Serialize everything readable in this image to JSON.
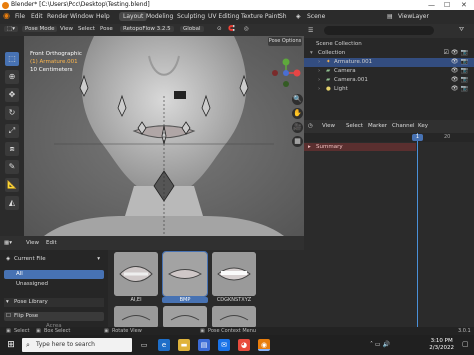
{
  "window": {
    "title": "Blender* [C:\\Users\\Pcc\\Desktop\\Testing.blend]",
    "minimize": "—",
    "maximize": "☐",
    "close": "✕"
  },
  "menubar": {
    "items": [
      "File",
      "Edit",
      "Render",
      "Window",
      "Help"
    ],
    "workspaces": [
      "Layout",
      "Modeling",
      "Sculpting",
      "UV Editing",
      "Texture Paint",
      "Sh"
    ],
    "active_workspace": "Layout",
    "scene_label": "Scene",
    "viewlayer_label": "ViewLayer"
  },
  "viewport_header": {
    "mode": "Pose Mode",
    "menus": [
      "View",
      "Select",
      "Pose"
    ],
    "addon": "RetopoFlow 3.2.5",
    "orientation": "Global",
    "pose_options": "Pose Options"
  },
  "viewport_info": {
    "view_name": "Front Orthographic",
    "selection": "(1) Armature.001",
    "scale": "10 Centimeters"
  },
  "outliner": {
    "root": "Scene Collection",
    "items": [
      {
        "label": "Collection",
        "indent": 1,
        "selected": false
      },
      {
        "label": "Armature.001",
        "indent": 2,
        "selected": true
      },
      {
        "label": "Camera",
        "indent": 2,
        "selected": false
      },
      {
        "label": "Camera.001",
        "indent": 2,
        "selected": false
      },
      {
        "label": "Light",
        "indent": 2,
        "selected": false
      }
    ]
  },
  "dopesheet": {
    "menus": [
      "View",
      "Select",
      "Marker",
      "Channel",
      "Key"
    ],
    "current_frame": "1",
    "ruler_marks": [
      "1",
      "20"
    ],
    "summary": "Summary"
  },
  "asset_browser": {
    "menus": [
      "View",
      "Edit"
    ],
    "library": "Current File",
    "categories": [
      {
        "label": "All",
        "selected": true
      },
      {
        "label": "Unassigned",
        "selected": false
      }
    ],
    "panel_title": "Pose Library",
    "flip_pose": "Flip Pose",
    "cut_text": "Acrea",
    "thumbnails": [
      {
        "label": "AI,EI",
        "selected": false
      },
      {
        "label": "BMP",
        "selected": true
      },
      {
        "label": "CDGKNSTXYZ",
        "selected": false
      },
      {
        "label": "",
        "selected": false
      },
      {
        "label": "",
        "selected": false
      },
      {
        "label": "",
        "selected": false
      }
    ]
  },
  "statusbar": {
    "select": "Select",
    "box_select": "Box Select",
    "rotate_view": "Rotate View",
    "context_menu": "Pose Context Menu",
    "version": "3.0.1"
  },
  "taskbar": {
    "search_placeholder": "Type here to search",
    "time": "3:10 PM",
    "date": "2/3/2022"
  },
  "colors": {
    "accent": "#4772b3",
    "selection_orange": "#ffb84d",
    "summary_red": "#5a2f2f"
  }
}
